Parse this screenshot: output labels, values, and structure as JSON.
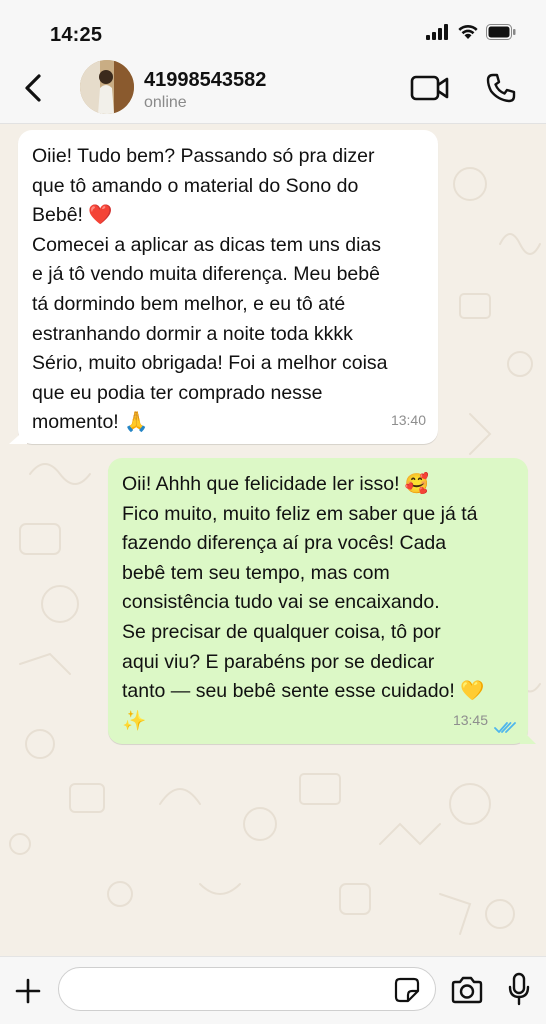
{
  "status_bar": {
    "time": "14:25",
    "icons": [
      "signal-icon",
      "wifi-icon",
      "battery-icon"
    ]
  },
  "header": {
    "contact_name": "41998543582",
    "contact_status": "online",
    "icons": [
      "back-arrow-icon",
      "video-call-icon",
      "phone-call-icon"
    ]
  },
  "messages": [
    {
      "direction": "incoming",
      "lines": [
        "Oiie! Tudo bem? Passando só pra dizer",
        "que tô amando o material do Sono do",
        "Bebê! ❤️",
        "Comecei a aplicar as dicas tem uns dias",
        "e já tô vendo muita diferença. Meu bebê",
        "tá dormindo bem melhor, e eu tô até",
        "estranhando dormir a noite toda kkkk",
        "Sério, muito obrigada! Foi a melhor coisa",
        "que eu podia ter comprado nesse",
        "momento! 🙏"
      ],
      "time": "13:40"
    },
    {
      "direction": "outgoing",
      "lines": [
        "Oii! Ahhh que felicidade ler isso! 🥰",
        "Fico muito, muito feliz em saber que já tá",
        "fazendo diferença aí pra vocês! Cada",
        "bebê tem seu tempo, mas com",
        "consistência tudo vai se encaixando.",
        "Se precisar de qualquer coisa, tô por",
        "aqui viu? E parabéns por se dedicar",
        "tanto — seu bebê sente esse cuidado! 💛",
        "✨"
      ],
      "time": "13:45",
      "read_receipt": "double-check-icon"
    }
  ],
  "input_bar": {
    "placeholder": "",
    "icons": [
      "plus-icon",
      "sticker-icon",
      "camera-icon",
      "microphone-icon"
    ]
  },
  "colors": {
    "incoming_bubble": "#ffffff",
    "outgoing_bubble": "#dcf8c6",
    "chat_background": "#f4efe7",
    "read_tick": "#4fb6ec"
  }
}
